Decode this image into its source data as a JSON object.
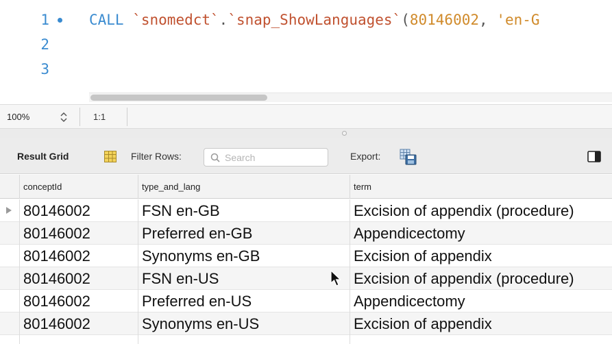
{
  "editor": {
    "lines": [
      {
        "number": "1",
        "has_marker": true
      },
      {
        "number": "2",
        "has_marker": false
      },
      {
        "number": "3",
        "has_marker": false
      }
    ],
    "statement": {
      "keyword": "CALL",
      "schema": "`snomedct`",
      "dot": ".",
      "procedure": "`snap_ShowLanguages`",
      "open_paren": "(",
      "arg1": "80146002",
      "comma": ", ",
      "arg2_partial": "'en-G"
    }
  },
  "statusbar": {
    "zoom": "100%",
    "ratio": "1:1"
  },
  "result_toolbar": {
    "title": "Result Grid",
    "filter_label": "Filter Rows:",
    "search_placeholder": "Search",
    "search_value": "",
    "export_label": "Export:"
  },
  "grid": {
    "columns": [
      "conceptId",
      "type_and_lang",
      "term"
    ],
    "rows": [
      {
        "conceptId": "80146002",
        "type_and_lang": "FSN en-GB",
        "term": "Excision of appendix (procedure)",
        "current": true
      },
      {
        "conceptId": "80146002",
        "type_and_lang": "Preferred en-GB",
        "term": "Appendicectomy",
        "current": false
      },
      {
        "conceptId": "80146002",
        "type_and_lang": "Synonyms en-GB",
        "term": "Excision of appendix",
        "current": false
      },
      {
        "conceptId": "80146002",
        "type_and_lang": "FSN en-US",
        "term": "Excision of appendix (procedure)",
        "current": false
      },
      {
        "conceptId": "80146002",
        "type_and_lang": "Preferred en-US",
        "term": "Appendicectomy",
        "current": false
      },
      {
        "conceptId": "80146002",
        "type_and_lang": "Synonyms en-US",
        "term": "Excision of appendix",
        "current": false
      }
    ]
  },
  "colors": {
    "line_number": "#3a8bd0",
    "keyword": "#3a8bd0",
    "identifier": "#c0512f",
    "literal": "#d08a2a",
    "toolbar_bg": "#ececec",
    "alt_row_bg": "#f5f5f5"
  },
  "icons": {
    "zoom_stepper": "up-down-chevron-icon",
    "grid_view": "grid-view-icon",
    "search": "search-icon",
    "export": "export-icon",
    "panel_toggle": "panel-toggle-icon",
    "row_marker": "current-row-marker-icon",
    "mouse_cursor": "mouse-pointer-icon"
  }
}
